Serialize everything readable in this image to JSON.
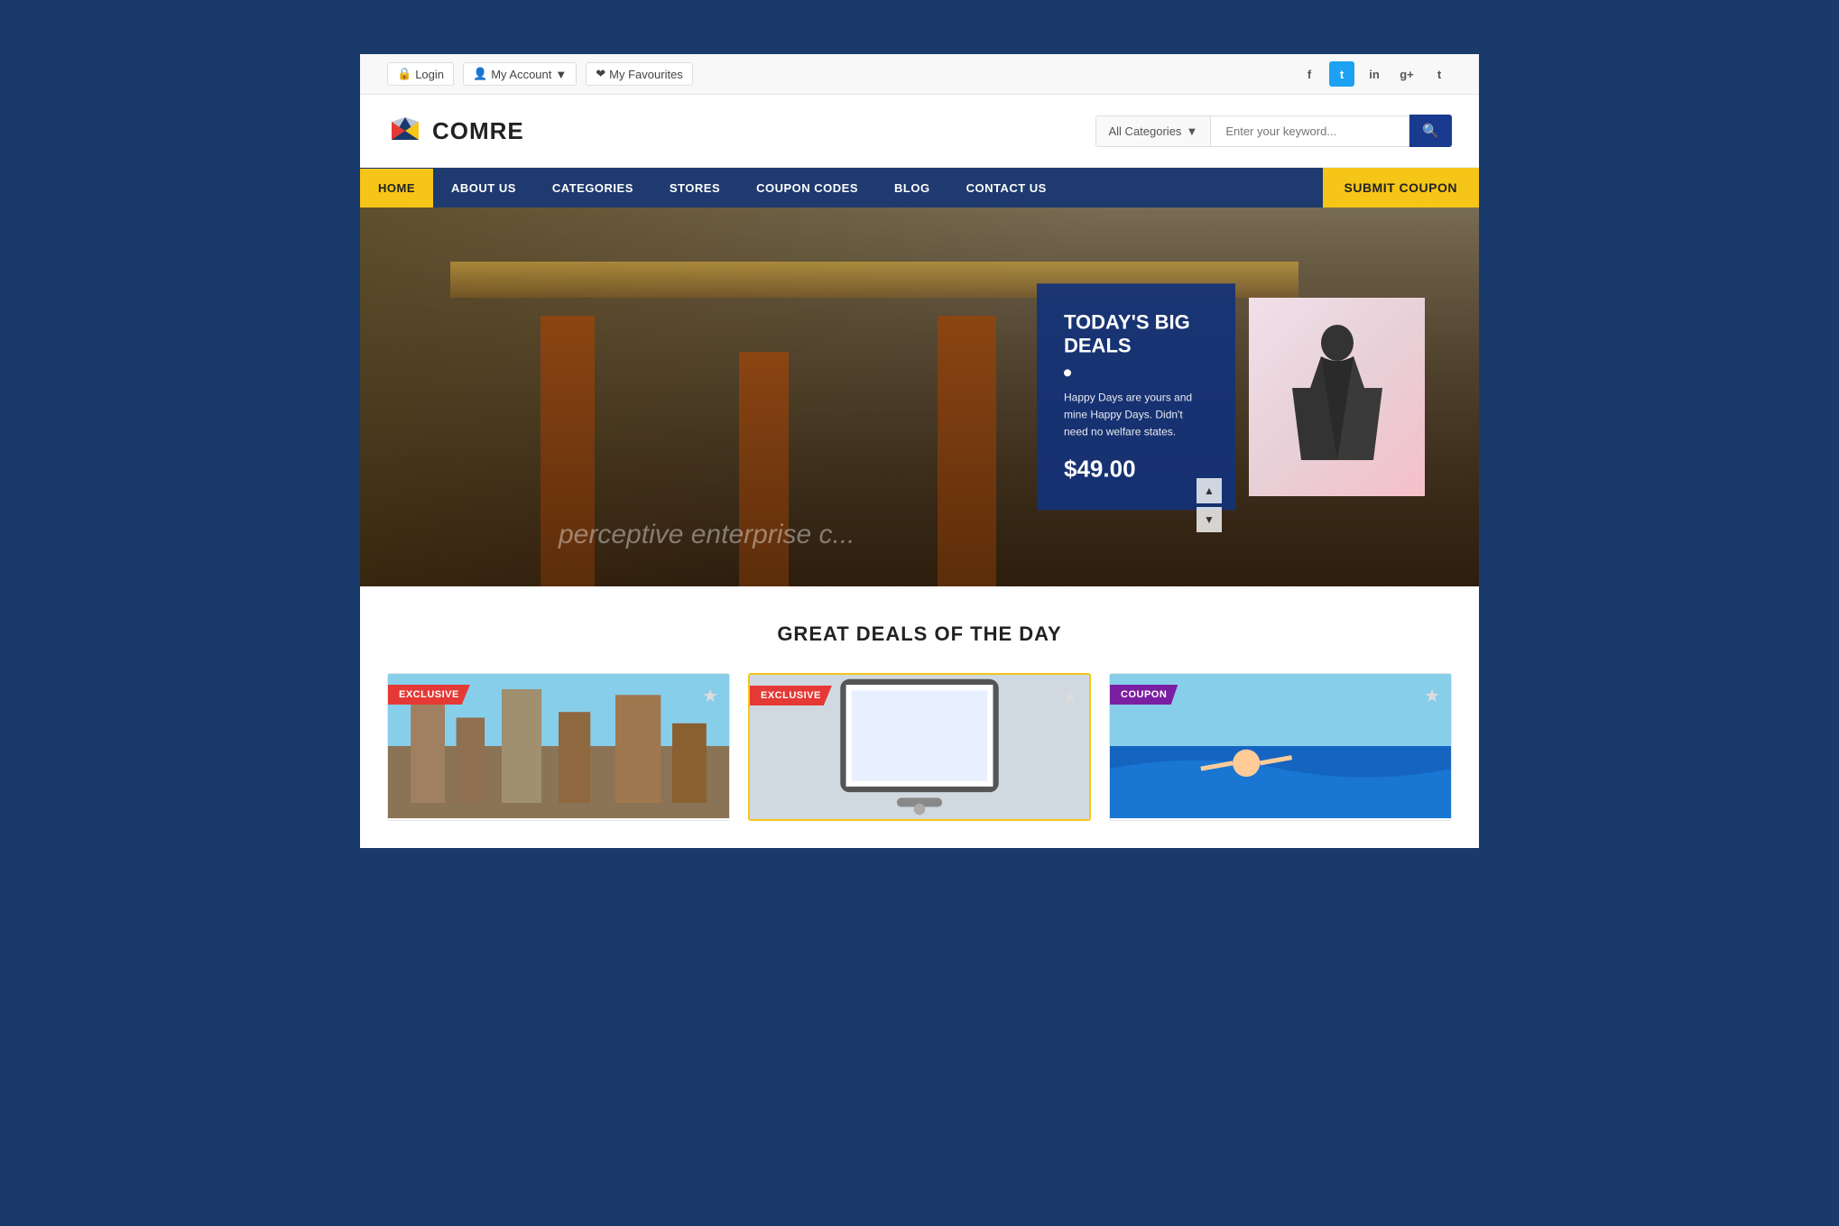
{
  "site": {
    "name": "COMRE",
    "background_color": "#1a3a6b"
  },
  "topbar": {
    "login_label": "Login",
    "my_account_label": "My Account",
    "my_favourites_label": "My Favourites",
    "social_icons": [
      "f",
      "t",
      "in",
      "g+",
      "t2"
    ]
  },
  "header": {
    "logo_text": "COMRE",
    "search_placeholder": "Enter your keyword...",
    "category_label": "All Categories"
  },
  "nav": {
    "items": [
      {
        "label": "HOME",
        "active": true
      },
      {
        "label": "ABOUT US",
        "active": false
      },
      {
        "label": "CATEGORIES",
        "active": false
      },
      {
        "label": "STORES",
        "active": false
      },
      {
        "label": "COUPON CODES",
        "active": false
      },
      {
        "label": "BLOG",
        "active": false
      },
      {
        "label": "CONTACT US",
        "active": false
      }
    ],
    "submit_coupon_label": "SUBMIT COUPON"
  },
  "hero": {
    "deal_title": "TODAY'S BIG DEALS",
    "deal_text": "Happy Days are yours and mine Happy Days. Didn't need no welfare states.",
    "deal_price": "$49.00",
    "slide_text": "perceptive enterprise c..."
  },
  "deals_section": {
    "title": "GREAT DEALS OF THE DAY",
    "cards": [
      {
        "badge": "EXCLUSIVE",
        "badge_type": "exclusive",
        "img_type": "city"
      },
      {
        "badge": "EXCLUSIVE",
        "badge_type": "exclusive",
        "img_type": "tech"
      },
      {
        "badge": "COUPON",
        "badge_type": "coupon",
        "img_type": "sport"
      }
    ]
  }
}
